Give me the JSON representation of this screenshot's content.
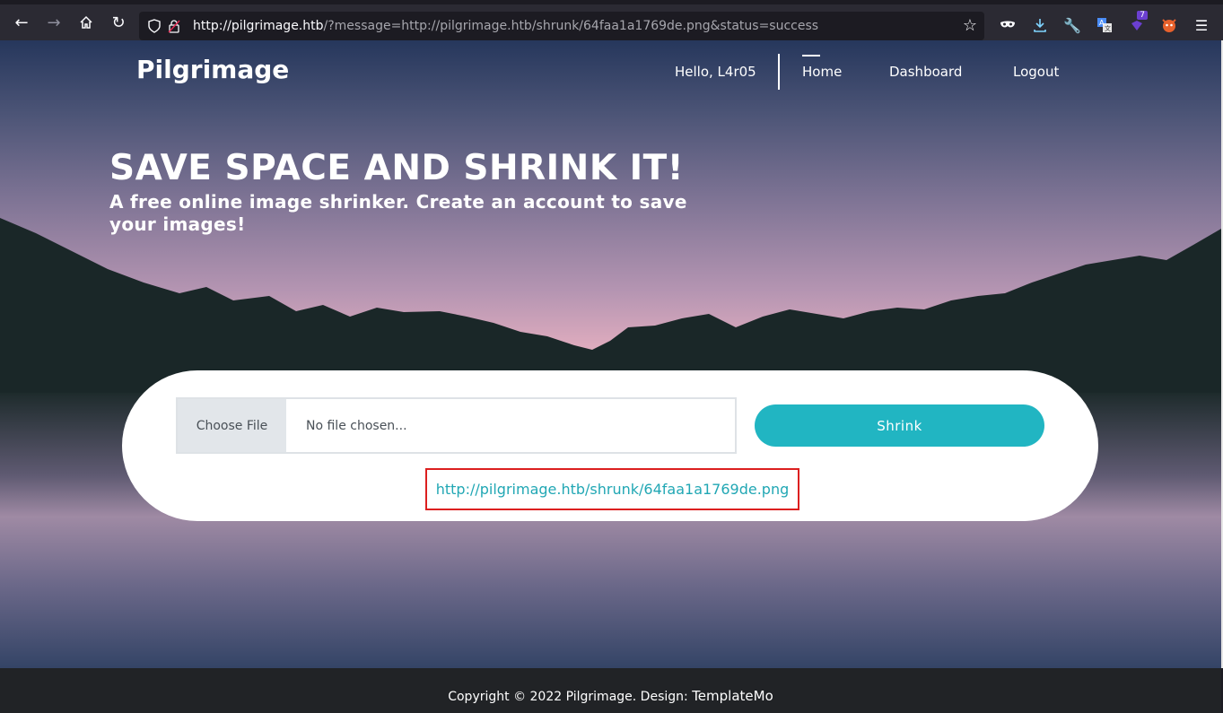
{
  "browser": {
    "url_host": "http://pilgrimage.htb",
    "url_rest": "/?message=http://pilgrimage.htb/shrunk/64faa1a1769de.png&status=success",
    "extension_badge": "7"
  },
  "nav": {
    "brand": "Pilgrimage",
    "greeting": "Hello, L4r05",
    "home": "Home",
    "dashboard": "Dashboard",
    "logout": "Logout"
  },
  "hero": {
    "title": "SAVE SPACE AND SHRINK IT!",
    "subtitle": "A free online image shrinker. Create an account to save your images!"
  },
  "upload": {
    "choose_file": "Choose File",
    "file_placeholder": "No file chosen...",
    "shrink_button": "Shrink",
    "result_url": "http://pilgrimage.htb/shrunk/64faa1a1769de.png"
  },
  "footer": {
    "copyright": "Copyright © 2022 Pilgrimage. Design: ",
    "design_link": "TemplateMo"
  }
}
